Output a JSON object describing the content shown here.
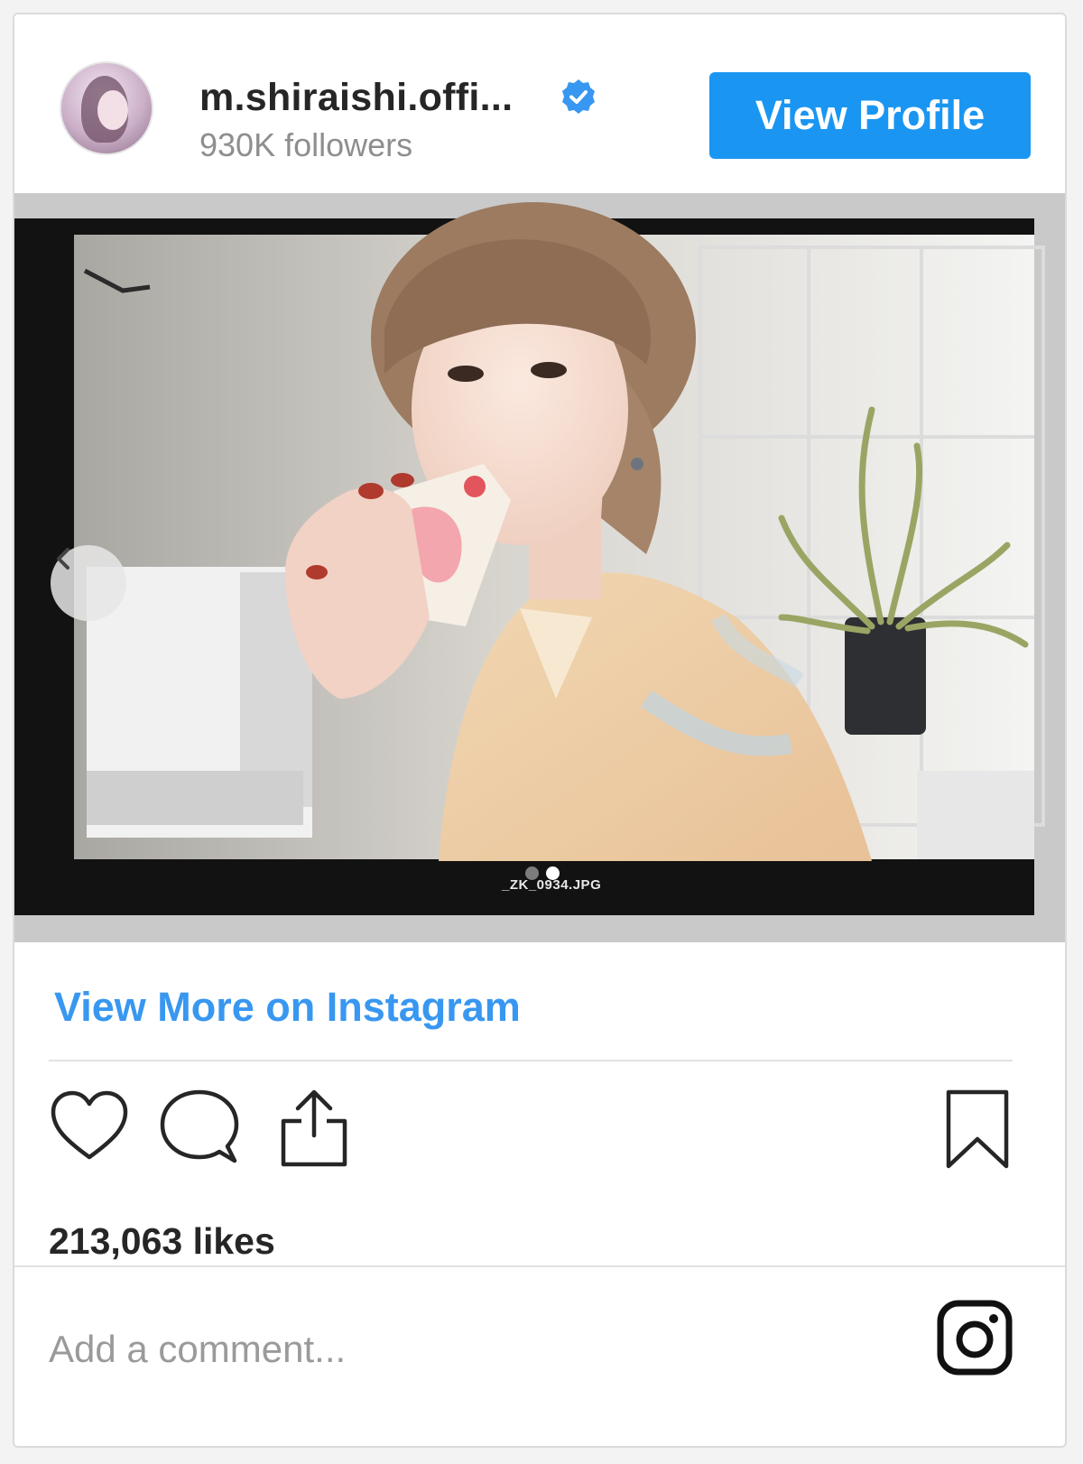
{
  "profile": {
    "username": "m.shiraishi.offi...",
    "followers": "930K followers",
    "verified": true,
    "view_profile_label": "View Profile"
  },
  "media": {
    "caption_filename": "_ZK_0934.JPG",
    "carousel_dots": 2,
    "active_dot": 2,
    "prev_icon": "chevron-left-icon"
  },
  "post": {
    "view_more_label": "View More on Instagram",
    "likes": "213,063 likes",
    "actions": [
      "heart-icon",
      "comment-icon",
      "share-icon"
    ],
    "save_icon": "bookmark-icon"
  },
  "comment": {
    "placeholder": "Add a comment...",
    "brand_icon": "instagram-icon"
  },
  "colors": {
    "accent": "#1a96f2",
    "link": "#3897f0",
    "muted_text": "#8e8e8e",
    "divider": "#e2e2e2"
  }
}
